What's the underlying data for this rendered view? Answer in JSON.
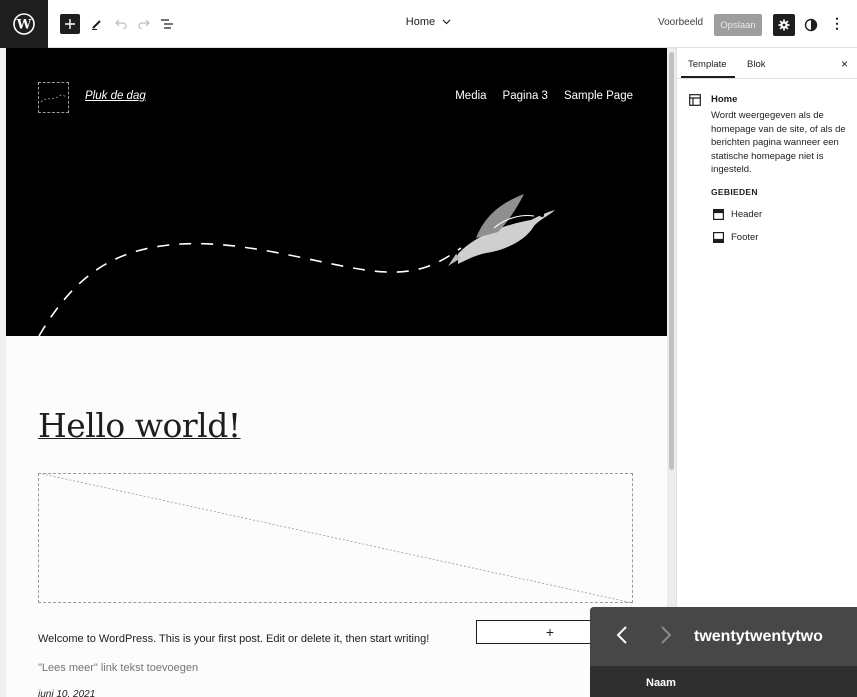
{
  "toolbar": {
    "document_title": "Home",
    "preview_label": "Voorbeeld",
    "save_label": "Opslaan",
    "more_label": "⋮"
  },
  "site": {
    "title": "Pluk de dag",
    "nav": [
      "Media",
      "Pagina 3",
      "Sample Page"
    ]
  },
  "post": {
    "title": "Hello world!",
    "excerpt": "Welcome to WordPress. This is your first post. Edit or delete it, then start writing!",
    "add_block_label": "+",
    "read_more_placeholder": "\"Lees meer\" link tekst toevoegen",
    "date": "juni 10, 2021"
  },
  "sidebar": {
    "tabs": [
      "Template",
      "Blok"
    ],
    "close_label": "×",
    "template_name": "Home",
    "template_description": "Wordt weergegeven als de homepage van de site, of als de berichten pagina wanneer een statische homepage niet is ingesteld.",
    "areas_heading": "GEBIEDEN",
    "areas": [
      "Header",
      "Footer"
    ]
  },
  "theme_panel": {
    "name": "twentytwentytwo",
    "column": "Naam"
  },
  "colors": {
    "toolbar_dark": "#1e1e1e",
    "hero_bg": "#000000",
    "save_disabled": "#9e9e9e",
    "theme_panel_bg": "#2f2f2f"
  }
}
